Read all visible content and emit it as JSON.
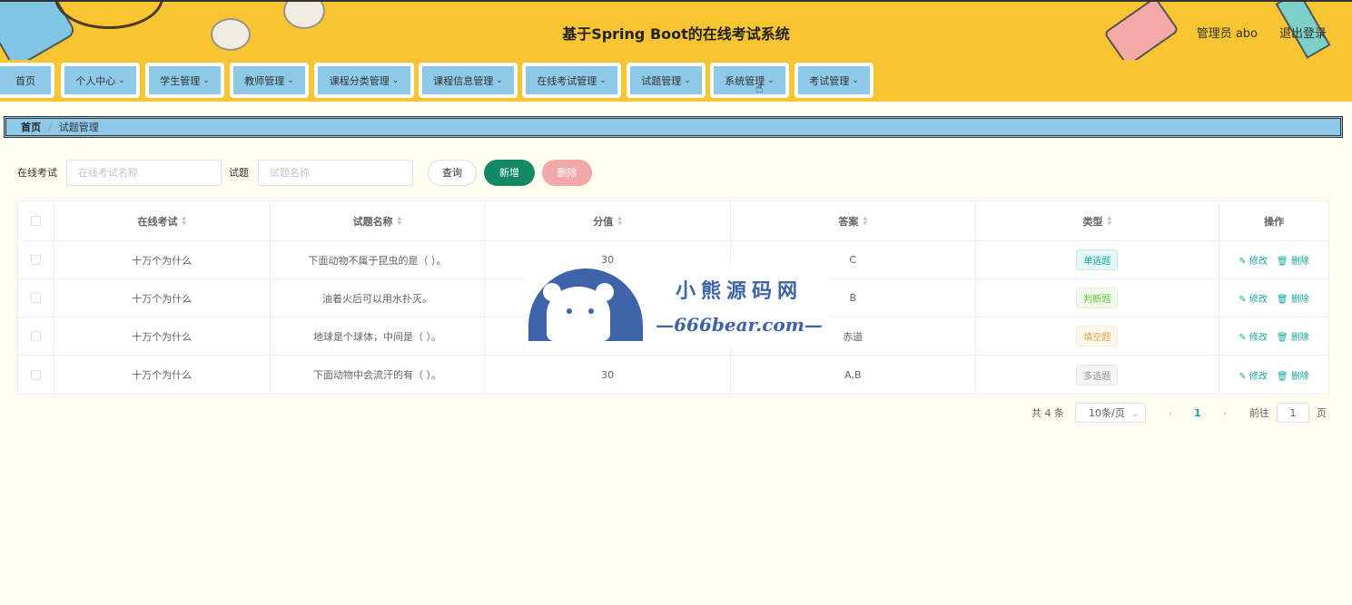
{
  "header": {
    "title": "基于Spring Boot的在线考试系统",
    "user": "管理员 abo",
    "logout": "退出登录"
  },
  "nav": [
    {
      "label": "首页",
      "has_menu": false
    },
    {
      "label": "个人中心",
      "has_menu": true
    },
    {
      "label": "学生管理",
      "has_menu": true
    },
    {
      "label": "教师管理",
      "has_menu": true
    },
    {
      "label": "课程分类管理",
      "has_menu": true
    },
    {
      "label": "课程信息管理",
      "has_menu": true
    },
    {
      "label": "在线考试管理",
      "has_menu": true
    },
    {
      "label": "试题管理",
      "has_menu": true
    },
    {
      "label": "系统管理",
      "has_menu": true
    },
    {
      "label": "考试管理",
      "has_menu": true
    }
  ],
  "breadcrumb": {
    "home": "首页",
    "separator": "/",
    "current": "试题管理"
  },
  "search": {
    "exam_label": "在线考试",
    "exam_placeholder": "在线考试名称",
    "question_label": "试题",
    "question_placeholder": "试题名称",
    "query_button": "查询",
    "add_button": "新增",
    "delete_button": "删除"
  },
  "table": {
    "columns": [
      "在线考试",
      "试题名称",
      "分值",
      "答案",
      "类型",
      "操作"
    ],
    "rows": [
      {
        "exam": "十万个为什么",
        "question": "下面动物不属于昆虫的是（ ）。",
        "score": "30",
        "answer": "C",
        "type": "单选题"
      },
      {
        "exam": "十万个为什么",
        "question": "油着火后可以用水扑灭。",
        "score": "",
        "answer": "B",
        "type": "判断题"
      },
      {
        "exam": "十万个为什么",
        "question": "地球是个球体，中间是（ ）。",
        "score": "",
        "answer": "赤道",
        "type": "填空题"
      },
      {
        "exam": "十万个为什么",
        "question": "下面动物中会流汗的有（ ）。",
        "score": "30",
        "answer": "A,B",
        "type": "多选题"
      }
    ],
    "edit_label": "修改",
    "delete_label": "删除"
  },
  "pagination": {
    "total": "共 4 条",
    "page_size": "10条/页",
    "current_page": "1",
    "goto_label": "前往",
    "goto_value": "1",
    "page_suffix": "页"
  },
  "watermark": {
    "line1": "小熊源码网",
    "line2": "—666bear.com—"
  },
  "colors": {
    "header_bg": "#f6c531",
    "nav_item_bg": "#8fc9e8",
    "primary": "#138a63",
    "danger_light": "#f0a8a8",
    "accent_text": "#13a89e"
  }
}
